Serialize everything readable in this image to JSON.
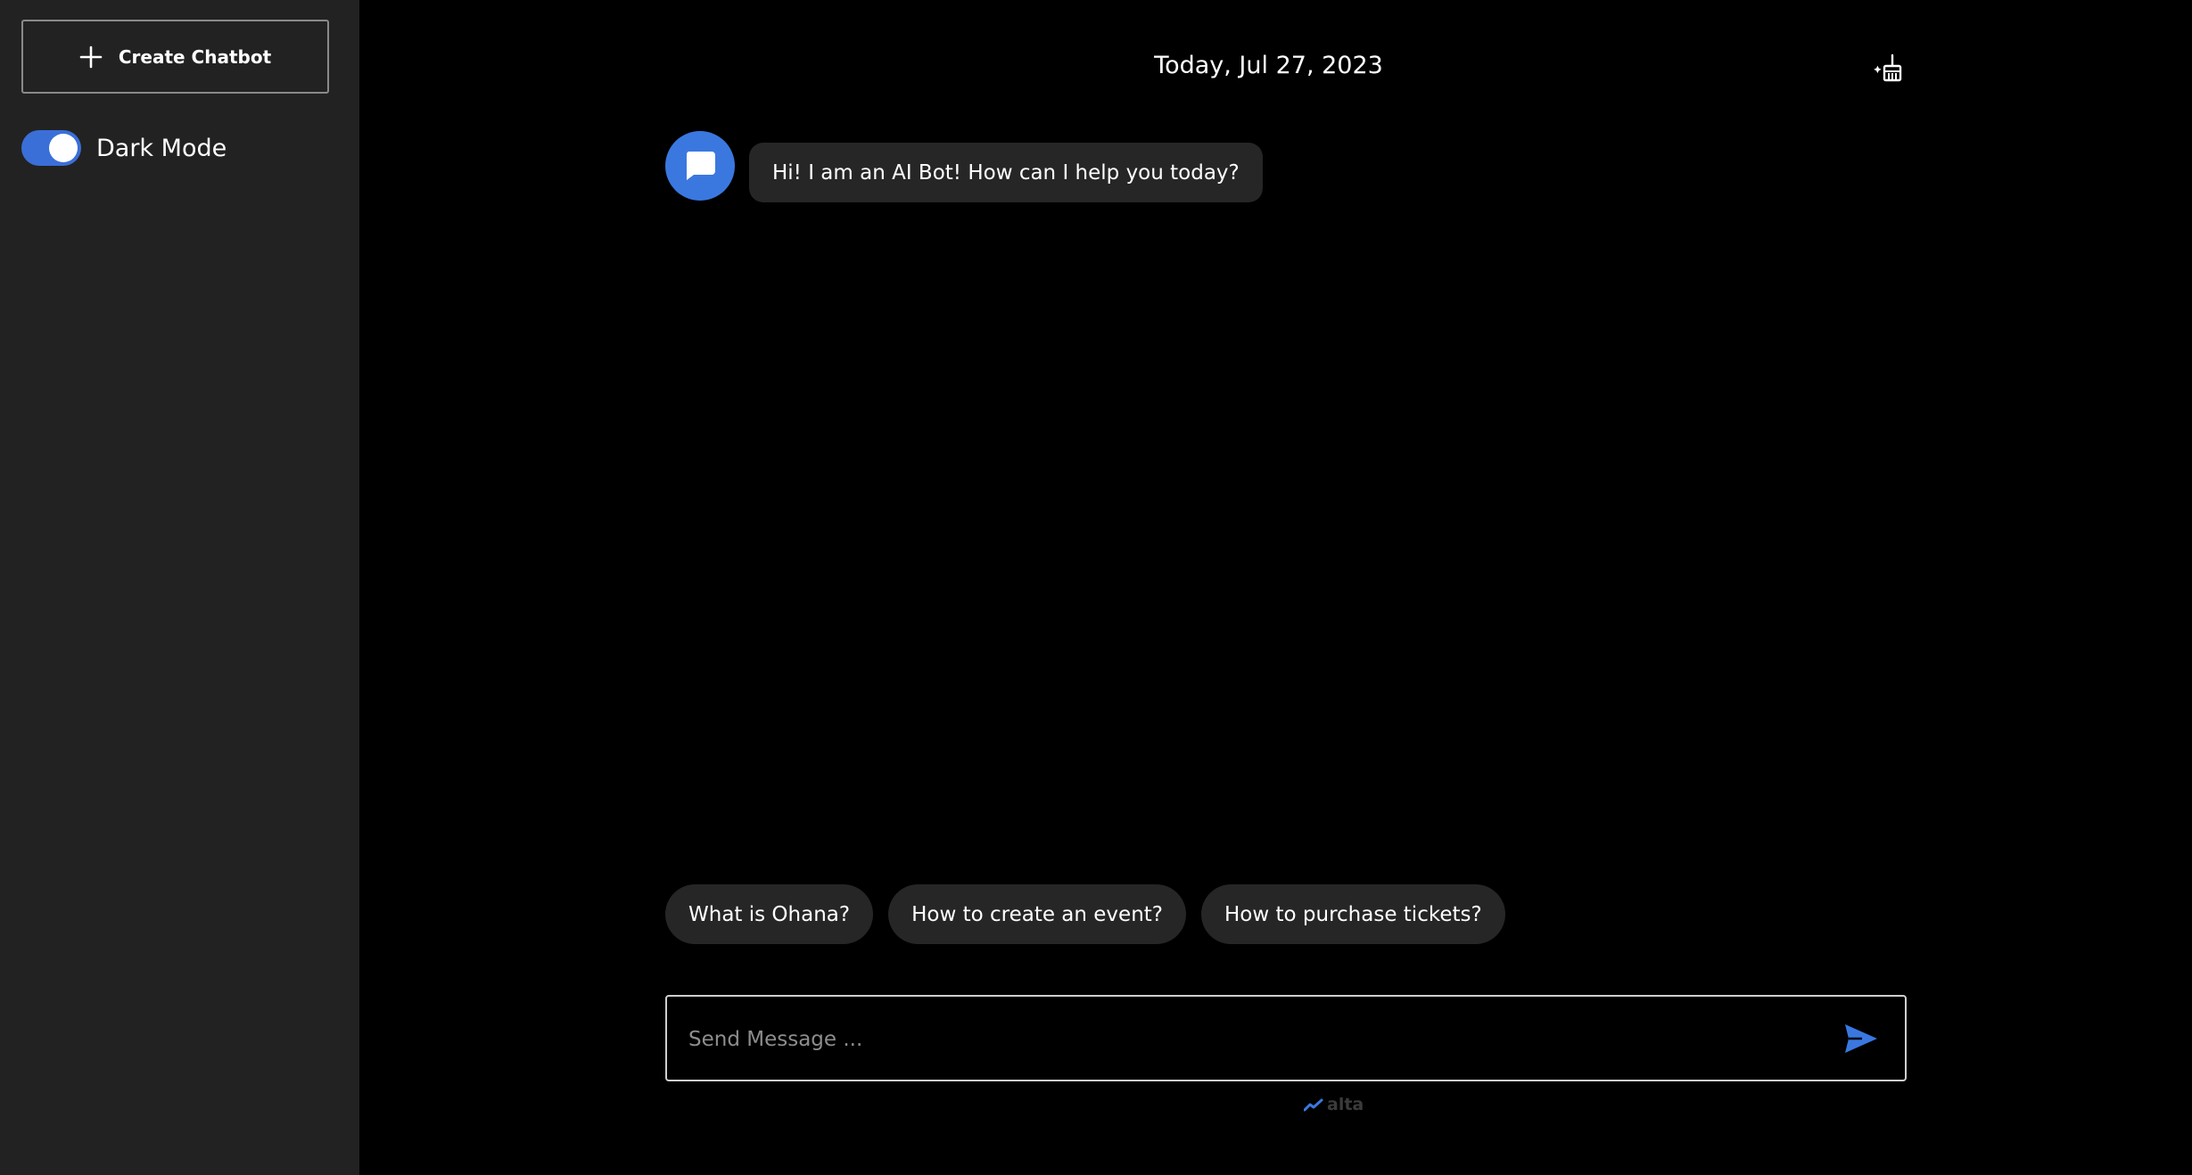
{
  "sidebar": {
    "create_button_label": "Create Chatbot",
    "create_icon": "plus-icon",
    "dark_mode": {
      "label": "Dark Mode",
      "enabled": true
    }
  },
  "header": {
    "date": "Today, Jul 27, 2023",
    "clear_icon": "clean-chat-icon"
  },
  "messages": [
    {
      "sender": "bot",
      "avatar_icon": "chat-bubble-icon",
      "text": "Hi! I am an AI Bot! How can I help you today?"
    }
  ],
  "suggestions": [
    "What is Ohana?",
    "How to create an event?",
    "How to purchase tickets?"
  ],
  "composer": {
    "placeholder": "Send Message ...",
    "value": "",
    "send_icon": "send-icon"
  },
  "branding": {
    "text": "alta",
    "icon": "trend-icon"
  },
  "colors": {
    "accent": "#3a78e0",
    "sidebar_bg": "#222222",
    "main_bg": "#000000",
    "bubble_bg": "#262626"
  }
}
